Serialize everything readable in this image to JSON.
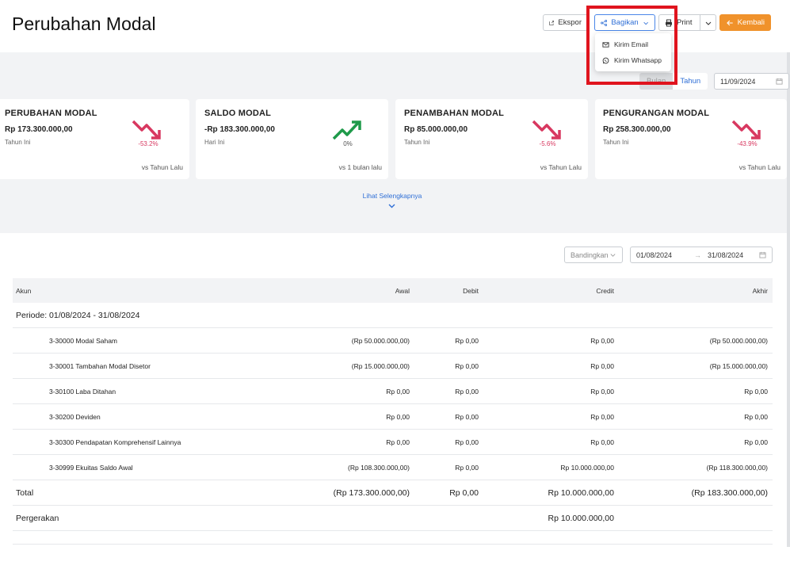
{
  "header": {
    "title": "Perubahan Modal",
    "ekspor_label": "Ekspor",
    "bagikan_label": "Bagikan",
    "print_label": "Print",
    "kembali_label": "Kembali"
  },
  "share_menu": {
    "items": [
      {
        "label": "Kirim Email",
        "icon": "mail-icon"
      },
      {
        "label": "Kirim Whatsapp",
        "icon": "whatsapp-icon"
      }
    ]
  },
  "period_toggle": {
    "options": [
      "Bulan",
      "Tahun"
    ],
    "selected": "Bulan"
  },
  "date_filter": {
    "value": "11/09/2024"
  },
  "cards": [
    {
      "title": "PERUBAHAN MODAL",
      "value": "Rp 173.300.000,00",
      "subtitle": "Tahun Ini",
      "percent": "-53.2%",
      "trend": "down",
      "compare": "vs Tahun Lalu"
    },
    {
      "title": "SALDO MODAL",
      "value": "-Rp 183.300.000,00",
      "subtitle": "Hari Ini",
      "percent": "0%",
      "trend": "up",
      "compare": "vs 1 bulan lalu"
    },
    {
      "title": "PENAMBAHAN MODAL",
      "value": "Rp 85.000.000,00",
      "subtitle": "Tahun Ini",
      "percent": "-5.6%",
      "trend": "down",
      "compare": "vs Tahun Lalu"
    },
    {
      "title": "PENGURANGAN MODAL",
      "value": "Rp 258.300.000,00",
      "subtitle": "Tahun Ini",
      "percent": "-43.9%",
      "trend": "down",
      "compare": "vs Tahun Lalu"
    }
  ],
  "see_more_label": "Lihat Selengkapnya",
  "table_filters": {
    "compare_label": "Bandingkan",
    "start_date": "01/08/2024",
    "end_date": "31/08/2024"
  },
  "table": {
    "headers": {
      "akun": "Akun",
      "awal": "Awal",
      "debit": "Debit",
      "credit": "Credit",
      "akhir": "Akhir"
    },
    "period_label": "Periode:",
    "period_value": "01/08/2024 - 31/08/2024",
    "rows": [
      {
        "akun": "3-30000 Modal Saham",
        "awal": "(Rp 50.000.000,00)",
        "debit": "Rp 0,00",
        "credit": "Rp 0,00",
        "akhir": "(Rp 50.000.000,00)"
      },
      {
        "akun": "3-30001 Tambahan Modal Disetor",
        "awal": "(Rp 15.000.000,00)",
        "debit": "Rp 0,00",
        "credit": "Rp 0,00",
        "akhir": "(Rp 15.000.000,00)"
      },
      {
        "akun": "3-30100 Laba Ditahan",
        "awal": "Rp 0,00",
        "debit": "Rp 0,00",
        "credit": "Rp 0,00",
        "akhir": "Rp 0,00"
      },
      {
        "akun": "3-30200 Deviden",
        "awal": "Rp 0,00",
        "debit": "Rp 0,00",
        "credit": "Rp 0,00",
        "akhir": "Rp 0,00"
      },
      {
        "akun": "3-30300 Pendapatan Komprehensif Lainnya",
        "awal": "Rp 0,00",
        "debit": "Rp 0,00",
        "credit": "Rp 0,00",
        "akhir": "Rp 0,00"
      },
      {
        "akun": "3-30999 Ekuitas Saldo Awal",
        "awal": "(Rp 108.300.000,00)",
        "debit": "Rp 0,00",
        "credit": "Rp 10.000.000,00",
        "akhir": "(Rp 118.300.000,00)"
      }
    ],
    "total": {
      "label": "Total",
      "awal": "(Rp 173.300.000,00)",
      "debit": "Rp 0,00",
      "credit": "Rp 10.000.000,00",
      "akhir": "(Rp 183.300.000,00)"
    },
    "movement": {
      "label": "Pergerakan",
      "credit": "Rp 10.000.000,00"
    }
  },
  "colors": {
    "primary": "#2f6fd6",
    "accent": "#f0922b",
    "negative": "#d83860",
    "positive": "#1e9a4a",
    "highlight": "#e0141e"
  }
}
